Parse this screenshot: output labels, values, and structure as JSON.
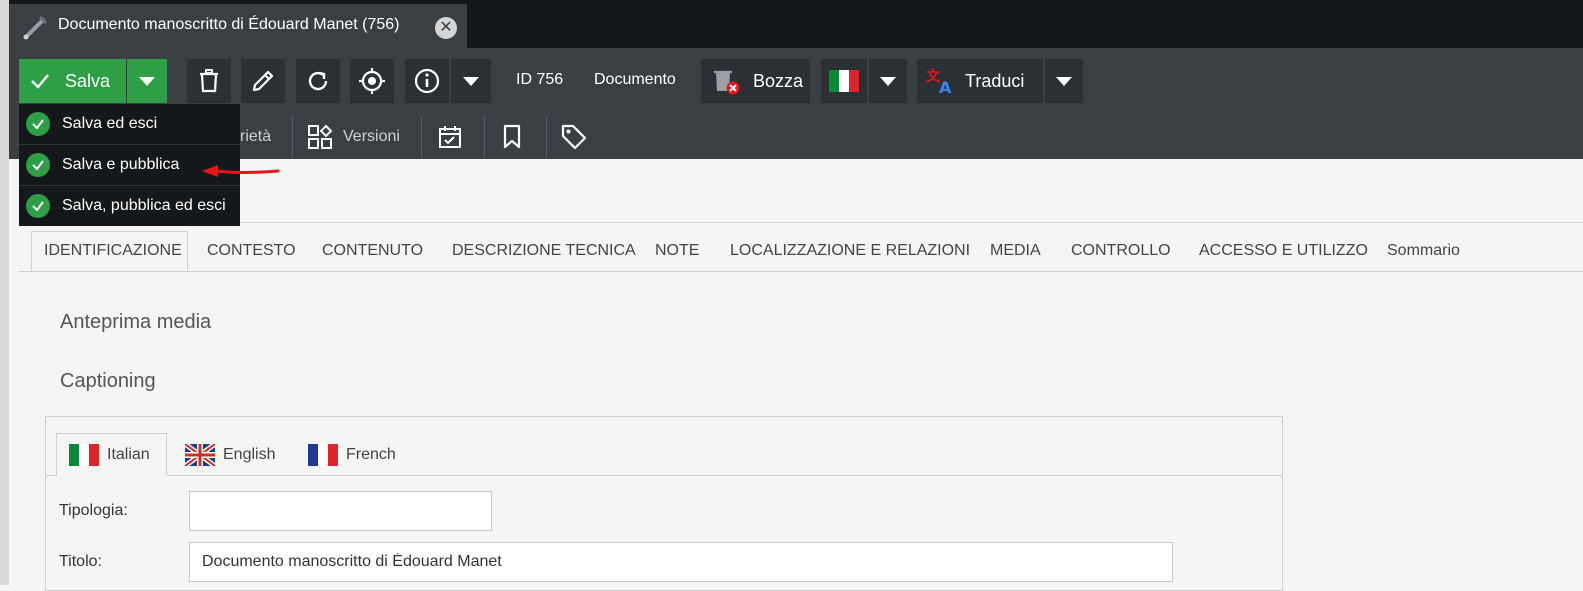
{
  "window": {
    "tab_title": "Documento manoscritto di Édouard Manet (756)",
    "close_symbol": "✕"
  },
  "toolbar": {
    "save_label": "Salva",
    "id_label": "ID 756",
    "type_label": "Documento",
    "draft_label": "Bozza",
    "translate_label": "Traduci",
    "icons": [
      "check-icon",
      "trash-icon",
      "pencil-icon",
      "reload-icon",
      "target-icon",
      "info-icon",
      "trash-x-icon",
      "italian-flag-icon",
      "translate-icon"
    ]
  },
  "save_menu": {
    "items": [
      {
        "label": "Salva ed esci"
      },
      {
        "label": "Salva e pubblica"
      },
      {
        "label": "Salva, pubblica ed esci"
      }
    ]
  },
  "subtoolbar": {
    "properties_partial": "rietà",
    "versions_label": "Versioni"
  },
  "tabs": [
    {
      "label": "IDENTIFICAZIONE",
      "active": true
    },
    {
      "label": "CONTESTO"
    },
    {
      "label": "CONTENUTO"
    },
    {
      "label": "DESCRIZIONE TECNICA"
    },
    {
      "label": "NOTE"
    },
    {
      "label": "LOCALIZZAZIONE E RELAZIONI"
    },
    {
      "label": "MEDIA"
    },
    {
      "label": "CONTROLLO"
    },
    {
      "label": "ACCESSO E UTILIZZO"
    },
    {
      "label": "Sommario"
    }
  ],
  "sections": {
    "media_preview": "Anteprima media",
    "captioning": "Captioning"
  },
  "languages": [
    {
      "label": "Italian",
      "active": true
    },
    {
      "label": "English"
    },
    {
      "label": "French"
    }
  ],
  "form": {
    "tipologia_label": "Tipologia:",
    "tipologia_value": "",
    "titolo_label": "Titolo:",
    "titolo_value": "Documento manoscritto di Édouard Manet"
  },
  "colors": {
    "save_green": "#2e9f46",
    "toolbar_bg": "#3a3f44",
    "topbar_bg": "#15181a",
    "annotation_red": "#e8141b"
  }
}
